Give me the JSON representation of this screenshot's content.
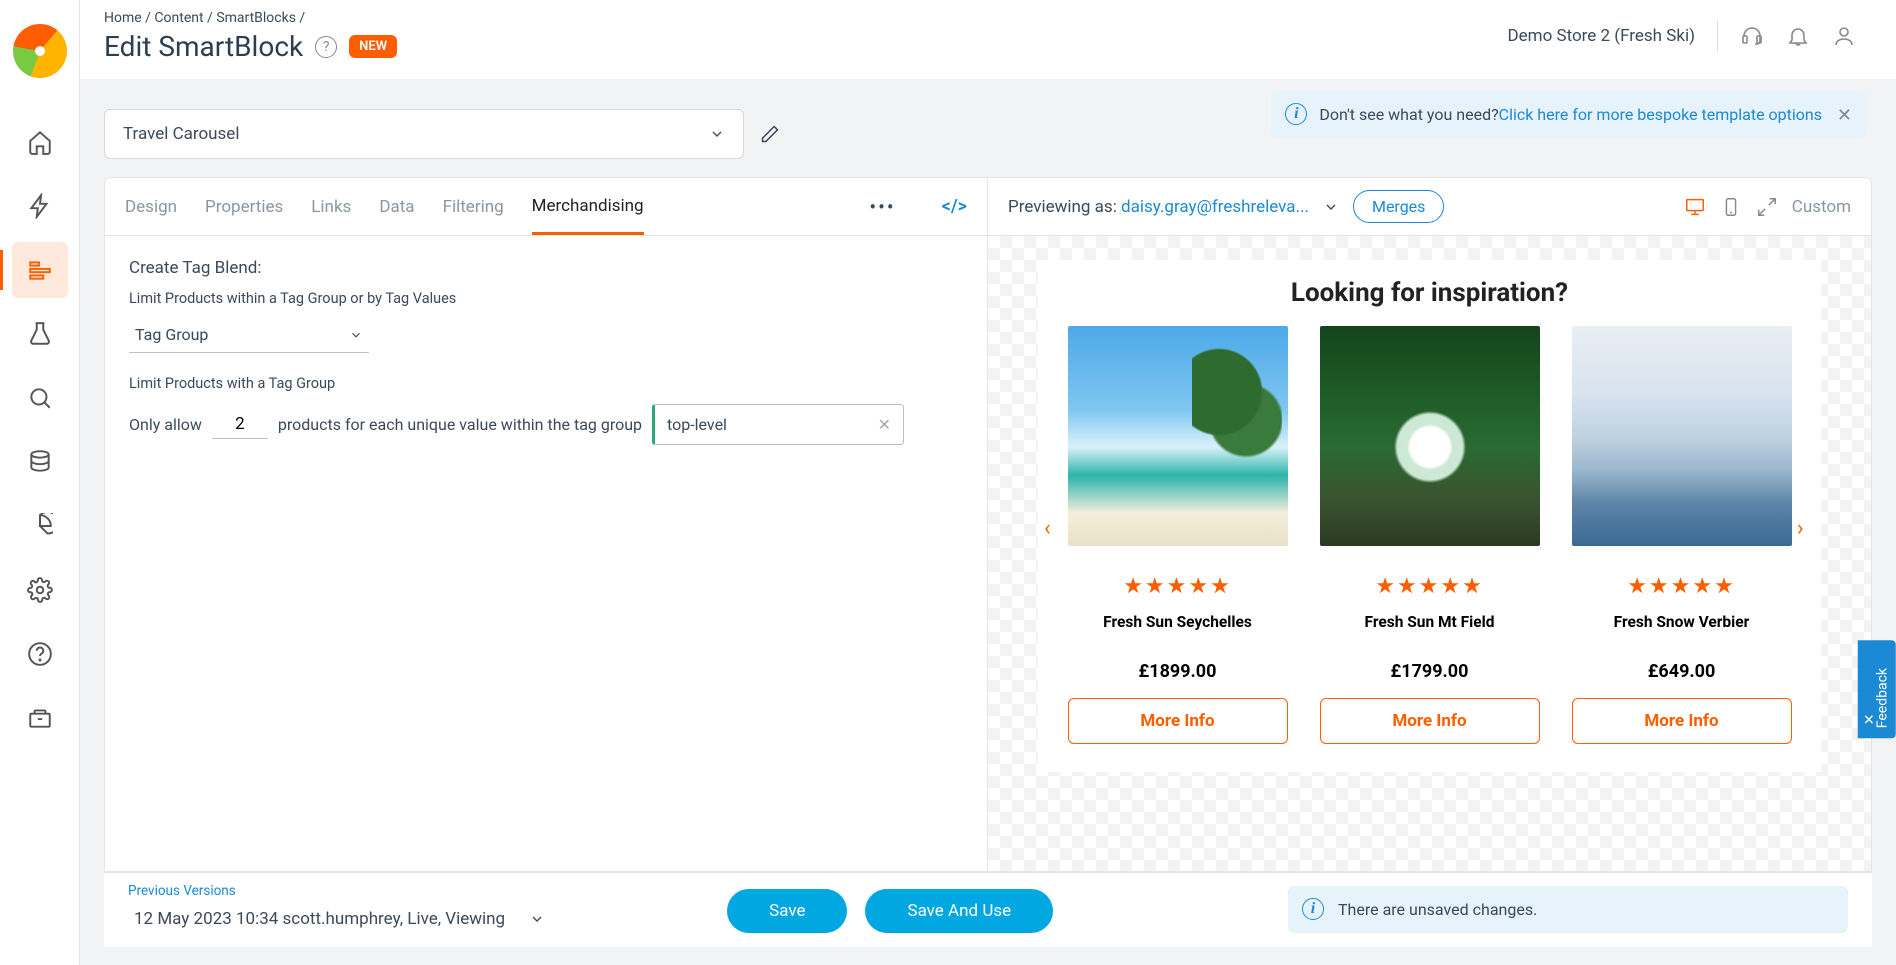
{
  "breadcrumbs": [
    "Home",
    "Content",
    "SmartBlocks"
  ],
  "page_title": "Edit SmartBlock",
  "new_badge": "NEW",
  "store_name": "Demo Store 2 (Fresh Ski)",
  "info_banner_text": "Don't see what you need? ",
  "info_banner_link": "Click here for more bespoke template options",
  "block_title": "Travel Carousel",
  "tabs": [
    "Design",
    "Properties",
    "Links",
    "Data",
    "Filtering",
    "Merchandising"
  ],
  "active_tab": "Merchandising",
  "form": {
    "heading": "Create Tag Blend:",
    "limit_label": "Limit Products within a Tag Group or by Tag Values",
    "tag_group_label": "Tag Group",
    "limit2_label": "Limit Products with a Tag Group",
    "only_allow_prefix": "Only allow",
    "only_allow_count": "2",
    "only_allow_suffix": "products for each unique value within the tag group",
    "tag_value": "top-level"
  },
  "preview": {
    "label_prefix": "Previewing as: ",
    "email": "daisy.gray@freshreleva...",
    "merges": "Merges",
    "custom": "Custom",
    "headline": "Looking for inspiration?",
    "more_info": "More Info",
    "products": [
      {
        "name": "Fresh Sun Seychelles",
        "price": "£1899.00",
        "img": "beach"
      },
      {
        "name": "Fresh Sun Mt Field",
        "price": "£1799.00",
        "img": "forest"
      },
      {
        "name": "Fresh Snow Verbier",
        "price": "£649.00",
        "img": "snow"
      }
    ]
  },
  "feedback_label": "Feedback",
  "footer": {
    "prev_label": "Previous Versions",
    "version": "12 May 2023 10:34 scott.humphrey, Live, Viewing",
    "save": "Save",
    "save_use": "Save And Use",
    "unsaved": "There are unsaved changes."
  }
}
